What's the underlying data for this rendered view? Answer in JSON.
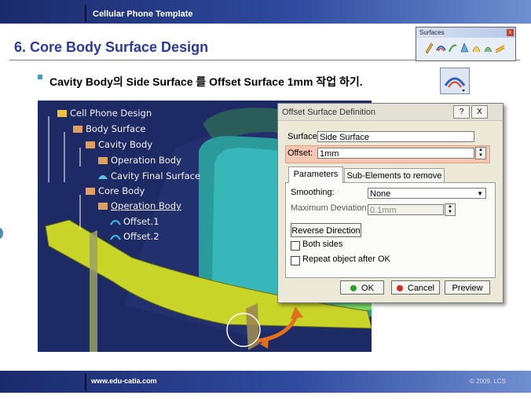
{
  "header": {
    "title": "Cellular Phone Template"
  },
  "slide": {
    "title": "6. Core Body Surface Design",
    "instruction": "Cavity Body의 Side Surface 를 Offset  Surface 1mm 작업 하기."
  },
  "surfaces_toolbar": {
    "title": "Surfaces"
  },
  "spec_tree": [
    "Cell Phone Design",
    "Body Surface",
    "Cavity Body",
    "Operation Body",
    "Cavity Final Surface",
    "Core Body",
    "Operation Body",
    "Offset.1",
    "Offset.2"
  ],
  "dialog": {
    "title": "Offset Surface Definition",
    "help_label": "?",
    "close_label": "X",
    "surface_label": "Surface:",
    "surface_value": "Side Surface",
    "offset_label": "Offset:",
    "offset_value": "1mm",
    "tabs": [
      "Parameters",
      "Sub-Elements to remove"
    ],
    "smoothing_label": "Smoothing:",
    "smoothing_value": "None",
    "max_dev_label": "Maximum Deviation:",
    "max_dev_value": "0.1mm",
    "reverse_label": "Reverse Direction",
    "both_sides_label": "Both sides",
    "repeat_label": "Repeat object after OK",
    "ok_label": "OK",
    "cancel_label": "Cancel",
    "preview_label": "Preview"
  },
  "footer": {
    "url": "www.edu-catia.com",
    "copyright": "© 2009. LCS"
  },
  "colors": {
    "accent": "#2a3a9a",
    "header_bar": "#2f4a9e",
    "offset_highlight": "#f6c8b4"
  }
}
